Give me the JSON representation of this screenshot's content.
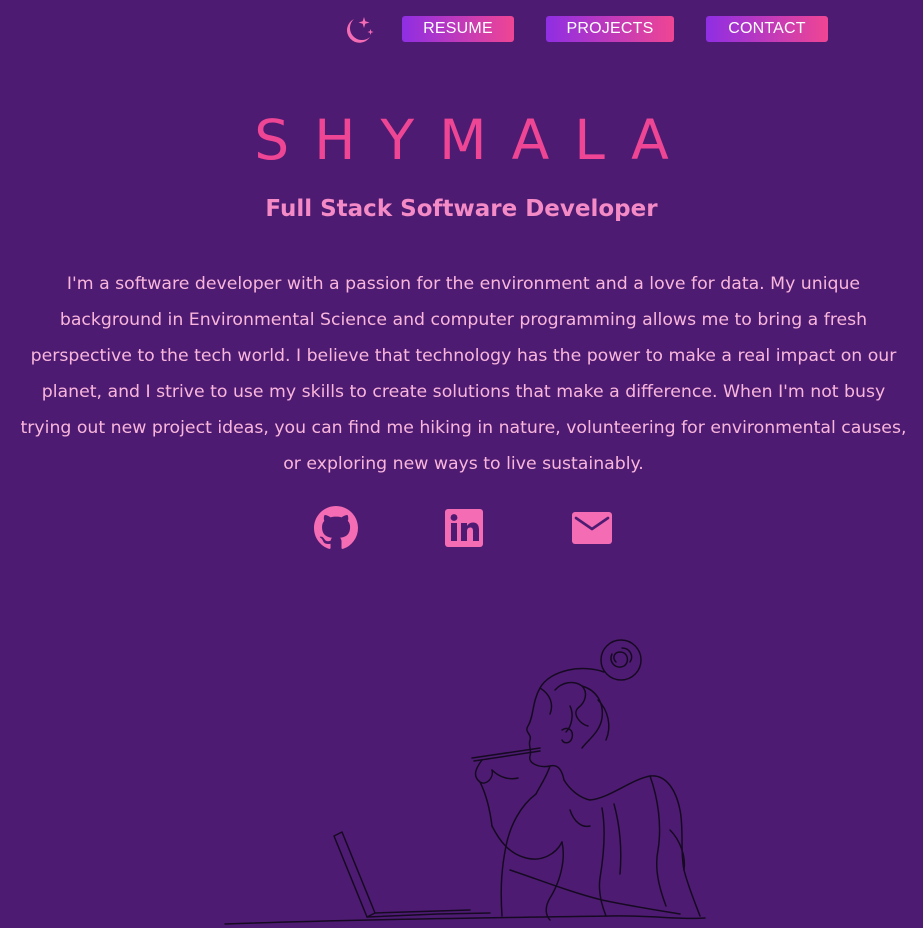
{
  "nav": {
    "theme_toggle_icon": "moon-stars-icon",
    "resume_label": "RESUME",
    "projects_label": "PROJECTS",
    "contact_label": "CONTACT",
    "gradient_start": "#8f2ee3",
    "gradient_end": "#ef4593"
  },
  "hero": {
    "name": "SHYMALA",
    "role": "Full Stack Software Developer",
    "bio": "I'm a software developer with a passion for the environment and a love for data. My unique background in Environmental Science and computer programming allows me to bring a fresh perspective to the tech world. I believe that technology has the power to make a real impact on our planet, and I strive to use my skills to create solutions that make a difference. When I'm not busy trying out new project ideas, you can find me hiking in nature, volunteering for environmental causes, or exploring new ways to live sustainably."
  },
  "social": {
    "github_icon": "github-icon",
    "linkedin_icon": "linkedin-icon",
    "email_icon": "mail-icon"
  },
  "illustration": {
    "icon": "woman-at-laptop-line-drawing"
  },
  "colors": {
    "background": "#4e1b72",
    "accent_pink": "#ee4594",
    "role_pink": "#f48ac6",
    "text_pink": "#f9b6dc",
    "icon_pink": "#f36cb4"
  }
}
